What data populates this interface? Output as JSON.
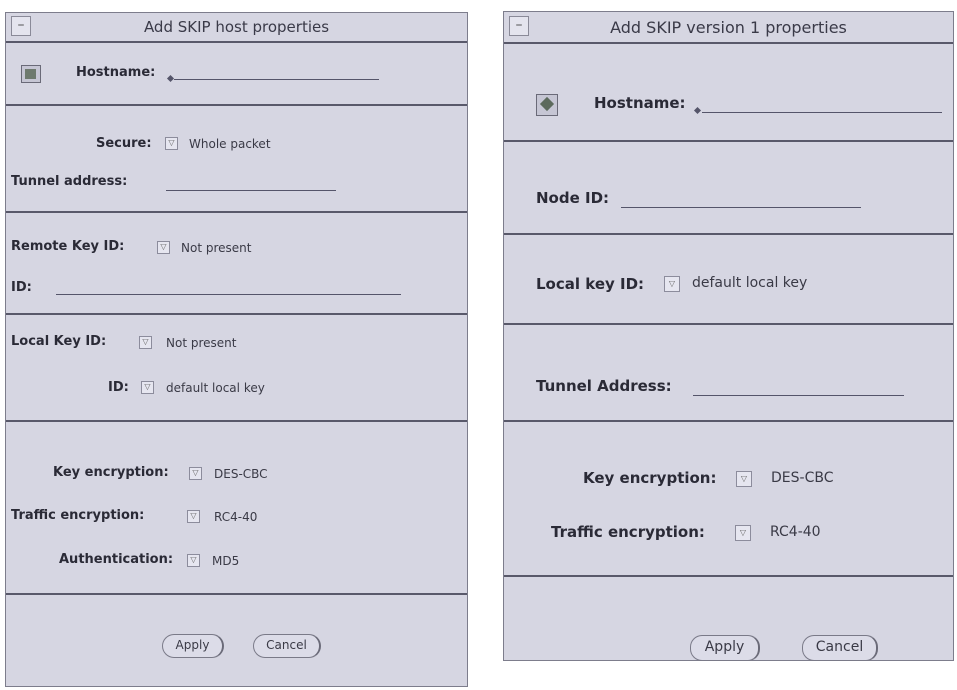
{
  "left_window": {
    "title": "Add SKIP host properties",
    "hostname_label": "Hostname:",
    "secure_label": "Secure:",
    "secure_value": "Whole packet",
    "tunnel_label": "Tunnel address:",
    "remote_key_label": "Remote Key ID:",
    "remote_key_value": "Not present",
    "remote_id_label": "ID:",
    "local_key_label": "Local Key ID:",
    "local_key_value": "Not present",
    "local_id_label": "ID:",
    "local_id_value": "default local key",
    "key_enc_label": "Key encryption:",
    "key_enc_value": "DES-CBC",
    "traffic_enc_label": "Traffic encryption:",
    "traffic_enc_value": "RC4-40",
    "auth_label": "Authentication:",
    "auth_value": "MD5",
    "apply": "Apply",
    "cancel": "Cancel"
  },
  "right_window": {
    "title": "Add SKIP version 1 properties",
    "hostname_label": "Hostname:",
    "node_label": "Node ID:",
    "local_key_label": "Local key ID:",
    "local_key_value": "default local key",
    "tunnel_label": "Tunnel Address:",
    "key_enc_label": "Key encryption:",
    "key_enc_value": "DES-CBC",
    "traffic_enc_label": "Traffic encryption:",
    "traffic_enc_value": "RC4-40",
    "apply": "Apply",
    "cancel": "Cancel"
  },
  "icons": {
    "window_menu": "window-menu-icon",
    "host": "host-icon",
    "choice": "choice-arrow-icon"
  }
}
